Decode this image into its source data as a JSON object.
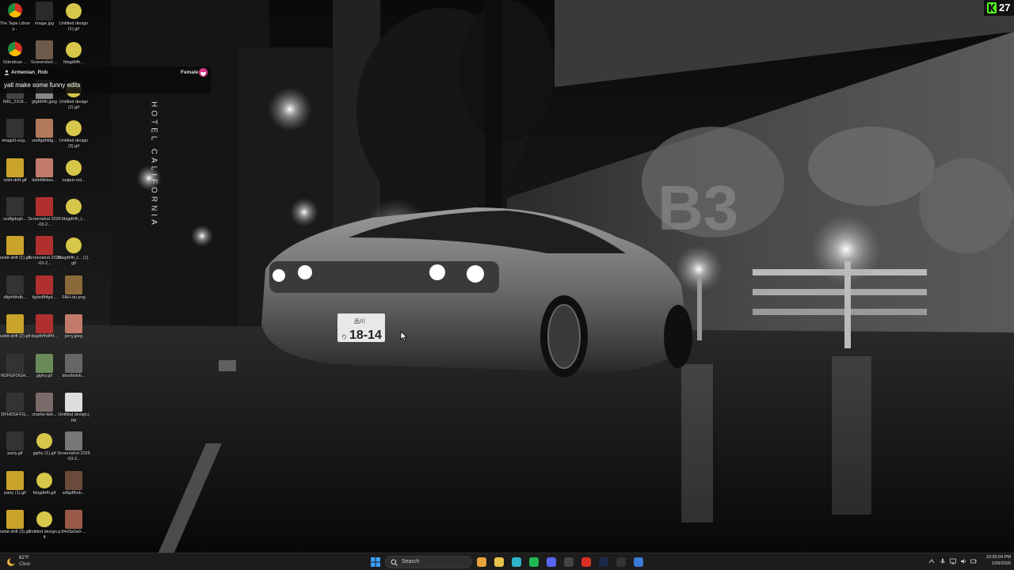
{
  "desktop_icons": [
    {
      "label": "The Tape Library...",
      "color": "#3b7dd8",
      "kind": "chrome"
    },
    {
      "label": "image.jpg",
      "color": "#2a2a2a",
      "kind": "dark"
    },
    {
      "label": "Untitled design (1).gif",
      "color": "#d6c64a",
      "kind": "yellow"
    },
    {
      "label": "Ddmdruw ...",
      "color": "#3b7dd8",
      "kind": "chrome"
    },
    {
      "label": "Screenshot ...",
      "color": "#6d5a4a",
      "kind": "face"
    },
    {
      "label": "fdsgdhfh...",
      "color": "#d6c64a",
      "kind": "yellow"
    },
    {
      "label": "IMG_2318...",
      "color": "#444",
      "kind": "dark"
    },
    {
      "label": "gfgfdhfh.jpeg",
      "color": "#888",
      "kind": "face"
    },
    {
      "label": "Untitled design (2).gif",
      "color": "#d6c64a",
      "kind": "yellow"
    },
    {
      "label": "image0-ezg...",
      "color": "#333",
      "kind": "dark"
    },
    {
      "label": "sedfgdhfdg...",
      "color": "#b07a5a",
      "kind": "face"
    },
    {
      "label": "Untitled design (3).gif",
      "color": "#d6c64a",
      "kind": "yellow"
    },
    {
      "label": "orbit-drift.gif",
      "color": "#c9a32a",
      "kind": "gold"
    },
    {
      "label": "dsfefdhbss...",
      "color": "#c27b6a",
      "kind": "face"
    },
    {
      "label": "output-onl...",
      "color": "#d6c64a",
      "kind": "yellow"
    },
    {
      "label": "szdfgdsgh...",
      "color": "#333",
      "kind": "dark"
    },
    {
      "label": "Screenshot 2026-03-2...",
      "color": "#b03030",
      "kind": "red"
    },
    {
      "label": "fdsgdhfh_t...",
      "color": "#d6c64a",
      "kind": "yellow"
    },
    {
      "label": "oebit-drift (1).gif",
      "color": "#c9a32a",
      "kind": "gold"
    },
    {
      "label": "Screenshot 2026-03-2...",
      "color": "#b03030",
      "kind": "red"
    },
    {
      "label": "fdsgdhfh_t... (1).gif",
      "color": "#d6c64a",
      "kind": "yellow"
    },
    {
      "label": "dfghfdhdb...",
      "color": "#333",
      "kind": "dark"
    },
    {
      "label": "fgdsdfhfgd...",
      "color": "#b03030",
      "kind": "red"
    },
    {
      "label": "FAH-du.png",
      "color": "#8a6a3a",
      "kind": "gold"
    },
    {
      "label": "oebit-drift (2).gif",
      "color": "#c9a32a",
      "kind": "gold"
    },
    {
      "label": "dsgdhfhdfhf...",
      "color": "#b03030",
      "kind": "red"
    },
    {
      "label": "jerry.jpeg",
      "color": "#c27b6a",
      "kind": "face"
    },
    {
      "label": "RDFGFDGH...",
      "color": "#333",
      "kind": "dark"
    },
    {
      "label": "giphy.gif",
      "color": "#6a8a5a",
      "kind": "face"
    },
    {
      "label": "dsvsfsdvb...",
      "color": "#666",
      "kind": "dark"
    },
    {
      "label": "DFHDGFFG...",
      "color": "#333",
      "kind": "dark"
    },
    {
      "label": "charlie-kirk...",
      "color": "#7a6a6a",
      "kind": "face"
    },
    {
      "label": "Untitled design.jpg",
      "color": "#ddd",
      "kind": "white"
    },
    {
      "label": "party.gif",
      "color": "#333",
      "kind": "dark"
    },
    {
      "label": "giphy (1).gif",
      "color": "#d6c64a",
      "kind": "yellow"
    },
    {
      "label": "Screenshot 2026-03-2...",
      "color": "#777",
      "kind": "face"
    },
    {
      "label": "party (1).gif",
      "color": "#c9a32a",
      "kind": "gold"
    },
    {
      "label": "fdsgdhfh.gif",
      "color": "#d6c64a",
      "kind": "yellow"
    },
    {
      "label": "sdfgdfhnb...",
      "color": "#6a4a3a",
      "kind": "face"
    },
    {
      "label": "oebit-drift (3).gif",
      "color": "#c9a32a",
      "kind": "gold"
    },
    {
      "label": "Untitled design.gif",
      "color": "#d6c64a",
      "kind": "yellow"
    },
    {
      "label": "84d3a0a0-...",
      "color": "#9a5a4a",
      "kind": "face"
    }
  ],
  "chat": {
    "username": "Armenian_Rob",
    "gender": "Female",
    "message": "yall make some funny edits"
  },
  "stream_badge": {
    "count": "27",
    "color": "#53fc18"
  },
  "wallpaper": {
    "plate_top": "品川",
    "plate_number": "18-14",
    "plate_prefix": "り",
    "sign": "HOTEL CALIFORNIA"
  },
  "taskbar": {
    "weather_temp": "62°F",
    "weather_cond": "Clear",
    "search_placeholder": "Search",
    "time": "10:55:04 PM",
    "date": "1/29/2026",
    "apps": [
      {
        "name": "start-button",
        "color": "#3aa0ff"
      },
      {
        "name": "chrome-app",
        "color": "#e8a33a"
      },
      {
        "name": "file-explorer-app",
        "color": "#e8c24a"
      },
      {
        "name": "edge-app",
        "color": "#2fb4c8"
      },
      {
        "name": "spotify-app",
        "color": "#1db954"
      },
      {
        "name": "discord-app",
        "color": "#5865f2"
      },
      {
        "name": "obs-app",
        "color": "#444"
      },
      {
        "name": "acrobat-app",
        "color": "#d93025"
      },
      {
        "name": "photoshop-app",
        "color": "#1b2a4a"
      },
      {
        "name": "window-app",
        "color": "#333"
      },
      {
        "name": "paint-app",
        "color": "#3a7bd5"
      }
    ]
  }
}
